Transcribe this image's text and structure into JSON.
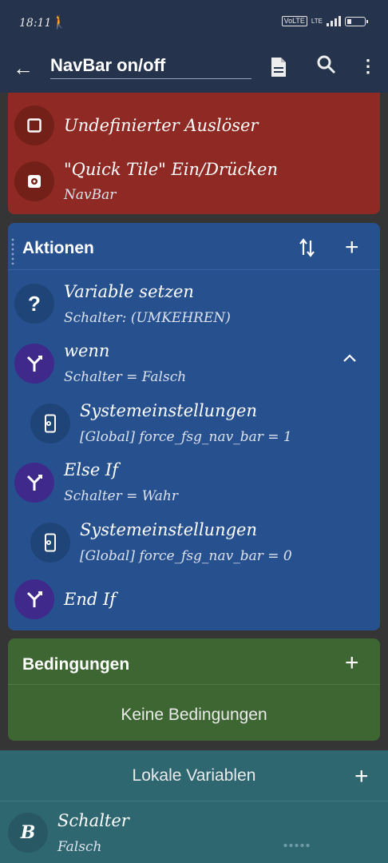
{
  "status_bar": {
    "time": "18:11",
    "volte": "VoLTE",
    "network": "LTE",
    "battery_level": 0.2
  },
  "app_bar": {
    "title": "NavBar on/off",
    "icons": [
      "back-arrow-icon",
      "document-icon",
      "search-icon",
      "more-vert-icon"
    ]
  },
  "triggers": {
    "items": [
      {
        "icon": "square-icon",
        "title": "Undefinierter Auslöser",
        "subtitle": ""
      },
      {
        "icon": "gear-icon",
        "title": "\"Quick Tile\" Ein/Drücken",
        "subtitle": "NavBar"
      }
    ]
  },
  "actions": {
    "title": "Aktionen",
    "items": [
      {
        "icon": "question-icon",
        "title": "Variable setzen",
        "subtitle": "Schalter: (UMKEHREN)"
      },
      {
        "icon": "fork-icon",
        "title": "wenn",
        "subtitle": "Schalter = Falsch"
      },
      {
        "icon": "phone-settings-icon",
        "title": "Systemeinstellungen",
        "subtitle": "[Global] force_fsg_nav_bar = 1"
      },
      {
        "icon": "fork-icon",
        "title": "Else If",
        "subtitle": "Schalter = Wahr"
      },
      {
        "icon": "phone-settings-icon",
        "title": "Systemeinstellungen",
        "subtitle": "[Global] force_fsg_nav_bar = 0"
      },
      {
        "icon": "fork-icon",
        "title": "End If",
        "subtitle": ""
      }
    ]
  },
  "conditions": {
    "title": "Bedingungen",
    "empty_text": "Keine Bedingungen"
  },
  "local_variables": {
    "title": "Lokale Variablen",
    "items": [
      {
        "icon_letter": "B",
        "name": "Schalter",
        "value": "Falsch"
      }
    ]
  },
  "colors": {
    "triggers_bg": "#8e2a23",
    "actions_bg": "#27508f",
    "conditions_bg": "#3d6632",
    "local_vars_bg": "#2f6771",
    "app_bar_bg": "#25334c"
  }
}
